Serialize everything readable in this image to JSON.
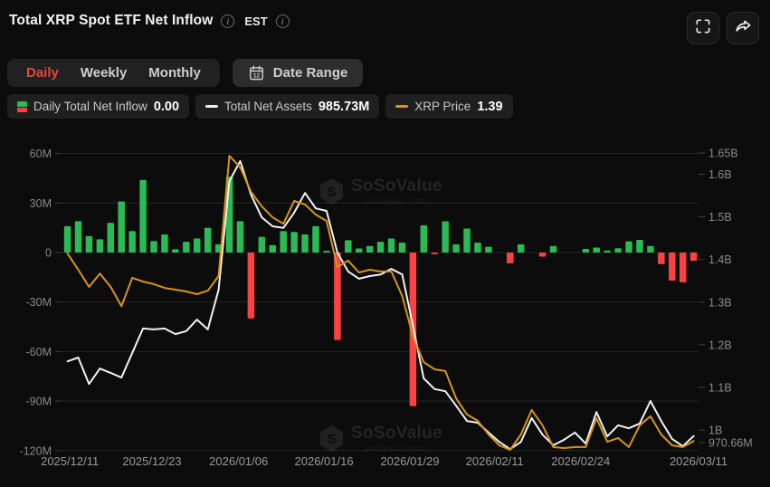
{
  "header": {
    "title": "Total XRP Spot ETF Net Inflow",
    "est_label": "EST"
  },
  "toolbar": {
    "tabs": [
      {
        "label": "Daily",
        "active": true
      },
      {
        "label": "Weekly",
        "active": false
      },
      {
        "label": "Monthly",
        "active": false
      }
    ],
    "date_range_label": "Date Range"
  },
  "legend": [
    {
      "label": "Daily Total Net Inflow",
      "value": "0.00",
      "icon": "green-red-bar"
    },
    {
      "label": "Total Net Assets",
      "value": "985.73M",
      "icon": "white-dash"
    },
    {
      "label": "XRP Price",
      "value": "1.39",
      "icon": "orange-dash"
    }
  ],
  "watermark": {
    "name": "SoSoValue",
    "domain": "sosovalue.com"
  },
  "colors": {
    "background": "#0c0c0c",
    "bar_positive": "#2abb54",
    "bar_negative": "#fb4242",
    "net_assets_line": "#f2f2f2",
    "price_line": "#d6951c",
    "active_tab": "#e5483d",
    "grid": "#262626",
    "axis_text": "#8a8a8a"
  },
  "chart_data": {
    "type": "bar+line",
    "title": "Total XRP Spot ETF Net Inflow (Daily)",
    "x_ticks": {
      "labels": [
        "2025/12/11",
        "2025/12/23",
        "2026/01/06",
        "2026/01/16",
        "2026/01/29",
        "2026/02/11",
        "2026/02/24",
        "2026/03/11"
      ],
      "fractions": [
        0.013,
        0.142,
        0.278,
        0.412,
        0.547,
        0.68,
        0.815,
        1.0
      ]
    },
    "left_axis": {
      "unit": "M",
      "ticks": [
        {
          "label": "60M",
          "value": 60
        },
        {
          "label": "30M",
          "value": 30
        },
        {
          "label": "0",
          "value": 0
        },
        {
          "label": "-30M",
          "value": -30
        },
        {
          "label": "-60M",
          "value": -60
        },
        {
          "label": "-90M",
          "value": -90
        },
        {
          "label": "-120M",
          "value": -120
        }
      ]
    },
    "right_axis": {
      "unit": "B",
      "ticks": [
        {
          "label": "1.65B",
          "value": 1.65
        },
        {
          "label": "1.6B",
          "value": 1.6
        },
        {
          "label": "1.5B",
          "value": 1.5
        },
        {
          "label": "1.4B",
          "value": 1.4
        },
        {
          "label": "1.3B",
          "value": 1.3
        },
        {
          "label": "1.2B",
          "value": 1.2
        },
        {
          "label": "1.1B",
          "value": 1.1
        },
        {
          "label": "1B",
          "value": 1.0
        },
        {
          "label": "970.66M",
          "value": 0.97066
        }
      ]
    },
    "bars": {
      "name": "Daily Total Net Inflow",
      "unit": "M",
      "values": [
        16,
        19,
        10,
        8,
        18,
        31,
        13,
        44,
        7,
        11,
        2,
        6.5,
        8.5,
        15,
        5,
        46,
        19,
        -40,
        9.5,
        4.5,
        13,
        12.5,
        11,
        16,
        1,
        -53,
        7.5,
        2.5,
        4,
        6.5,
        8.5,
        6,
        -93,
        16.5,
        -1,
        19,
        5,
        14.5,
        6,
        3.5,
        0,
        -6.5,
        5,
        0,
        -2.5,
        4,
        0,
        0,
        2.2,
        3,
        1.2,
        2.6,
        6.8,
        7.7,
        4,
        -7,
        -17,
        -18,
        -5
      ]
    },
    "series": [
      {
        "name": "Total Net Assets",
        "unit": "B",
        "color": "#f2f2f2",
        "values": [
          1.161,
          1.17,
          1.108,
          1.144,
          1.134,
          1.123,
          1.181,
          1.238,
          1.236,
          1.238,
          1.225,
          1.232,
          1.259,
          1.236,
          1.329,
          1.584,
          1.631,
          1.552,
          1.499,
          1.478,
          1.474,
          1.51,
          1.556,
          1.52,
          1.514,
          1.416,
          1.372,
          1.355,
          1.361,
          1.365,
          1.378,
          1.365,
          1.244,
          1.121,
          1.096,
          1.091,
          1.057,
          1.021,
          1.017,
          0.994,
          0.972,
          0.955,
          0.972,
          1.028,
          0.989,
          0.964,
          0.977,
          0.994,
          0.968,
          1.042,
          0.985,
          1.011,
          1.004,
          1.015,
          1.068,
          1.021,
          0.979,
          0.962,
          0.9857
        ]
      },
      {
        "name": "XRP Price",
        "unit": "USD",
        "color": "#d6951c",
        "axis": {
          "min": 1.355,
          "max": 2.53
        },
        "values": [
          2.132,
          2.068,
          2.0,
          2.053,
          2.0,
          1.924,
          2.036,
          2.021,
          2.011,
          1.996,
          1.989,
          1.982,
          1.971,
          1.985,
          2.043,
          2.519,
          2.473,
          2.376,
          2.319,
          2.275,
          2.25,
          2.34,
          2.326,
          2.286,
          2.261,
          2.079,
          2.104,
          2.057,
          2.068,
          2.061,
          2.061,
          1.964,
          1.803,
          1.702,
          1.674,
          1.667,
          1.559,
          1.495,
          1.47,
          1.416,
          1.373,
          1.355,
          1.416,
          1.513,
          1.452,
          1.366,
          1.362,
          1.366,
          1.366,
          1.48,
          1.387,
          1.402,
          1.366,
          1.452,
          1.488,
          1.416,
          1.373,
          1.366,
          1.39
        ]
      }
    ],
    "grid": true,
    "legend_position": "top-left"
  }
}
